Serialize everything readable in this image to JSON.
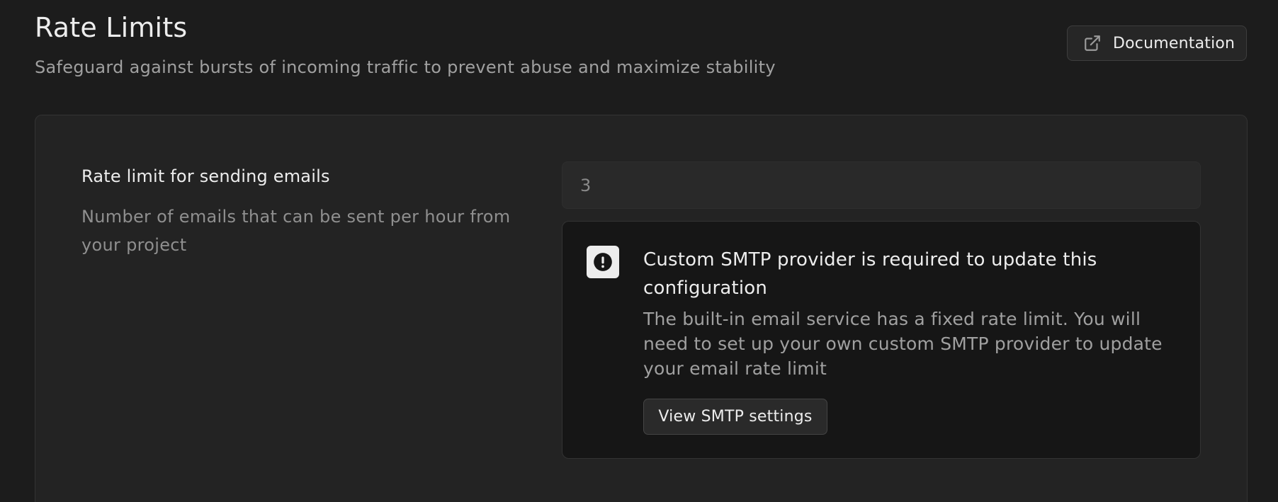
{
  "header": {
    "title": "Rate Limits",
    "subtitle": "Safeguard against bursts of incoming traffic to prevent abuse and maximize stability",
    "documentation_label": "Documentation",
    "documentation_icon": "external-link-icon"
  },
  "setting": {
    "label": "Rate limit for sending emails",
    "description": "Number of emails that can be sent per hour from your project",
    "input_value": "3"
  },
  "alert": {
    "icon": "exclamation-circle-icon",
    "title": "Custom SMTP provider is required to update this configuration",
    "body": "The built-in email service has a fixed rate limit. You will need to set up your own custom SMTP provider to update your email rate limit",
    "button_label": "View SMTP settings"
  },
  "colors": {
    "background": "#1c1c1c",
    "panel": "#232323",
    "alert_background": "#161616",
    "text_primary": "#ededed",
    "text_secondary": "#a0a0a0"
  }
}
